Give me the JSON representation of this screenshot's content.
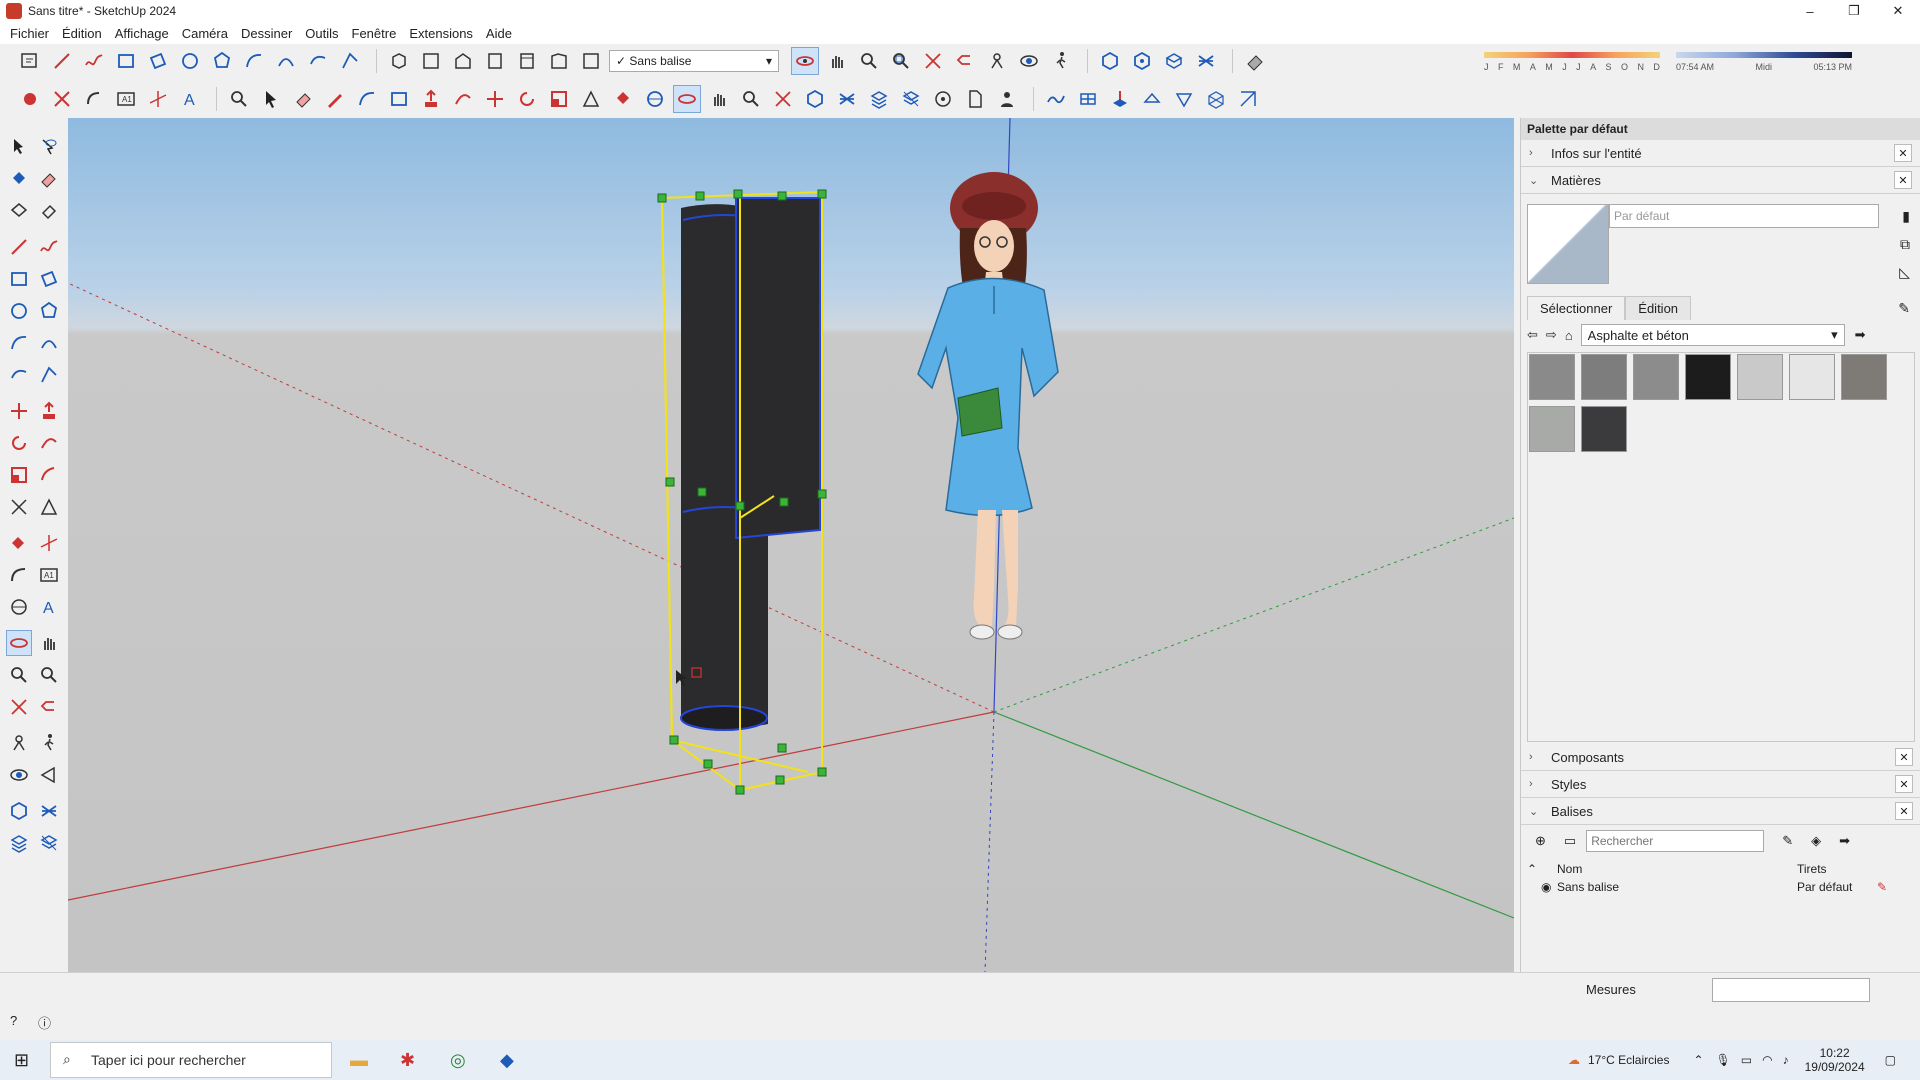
{
  "window": {
    "title": "Sans titre* - SketchUp 2024"
  },
  "menu": [
    "Fichier",
    "Édition",
    "Affichage",
    "Caméra",
    "Dessiner",
    "Outils",
    "Fenêtre",
    "Extensions",
    "Aide"
  ],
  "toolbar": {
    "tag_dropdown": "Sans balise",
    "shadow_months": [
      "J",
      "F",
      "M",
      "A",
      "M",
      "J",
      "J",
      "A",
      "S",
      "O",
      "N",
      "D"
    ],
    "shadow_times": [
      "07:54 AM",
      "Midi",
      "05:13 PM"
    ]
  },
  "panel": {
    "title": "Palette par défaut",
    "trays": {
      "entity_info": "Infos sur l'entité",
      "materials": "Matières",
      "components": "Composants",
      "styles": "Styles",
      "tags": "Balises"
    },
    "material_name_placeholder": "Par défaut",
    "tabs": [
      "Sélectionner",
      "Édition"
    ],
    "library": "Asphalte et béton",
    "swatch_colors": [
      "#8a8a8a",
      "#7d7d7d",
      "#8c8c8c",
      "#1c1c1c",
      "#c9c9c9",
      "#e6e6e6",
      "#7e7a75",
      "#a8aaa8",
      "#3b3b3d"
    ],
    "tags_search_placeholder": "Rechercher",
    "tags_headers": {
      "name": "Nom",
      "dashes": "Tirets"
    },
    "tags_rows": [
      {
        "name": "Sans balise",
        "dashes": "Par défaut"
      }
    ]
  },
  "status": {
    "measures_label": "Mesures"
  },
  "taskbar": {
    "search_placeholder": "Taper ici pour rechercher",
    "weather": "17°C  Eclaircies",
    "time": "10:22",
    "date": "19/09/2024"
  }
}
